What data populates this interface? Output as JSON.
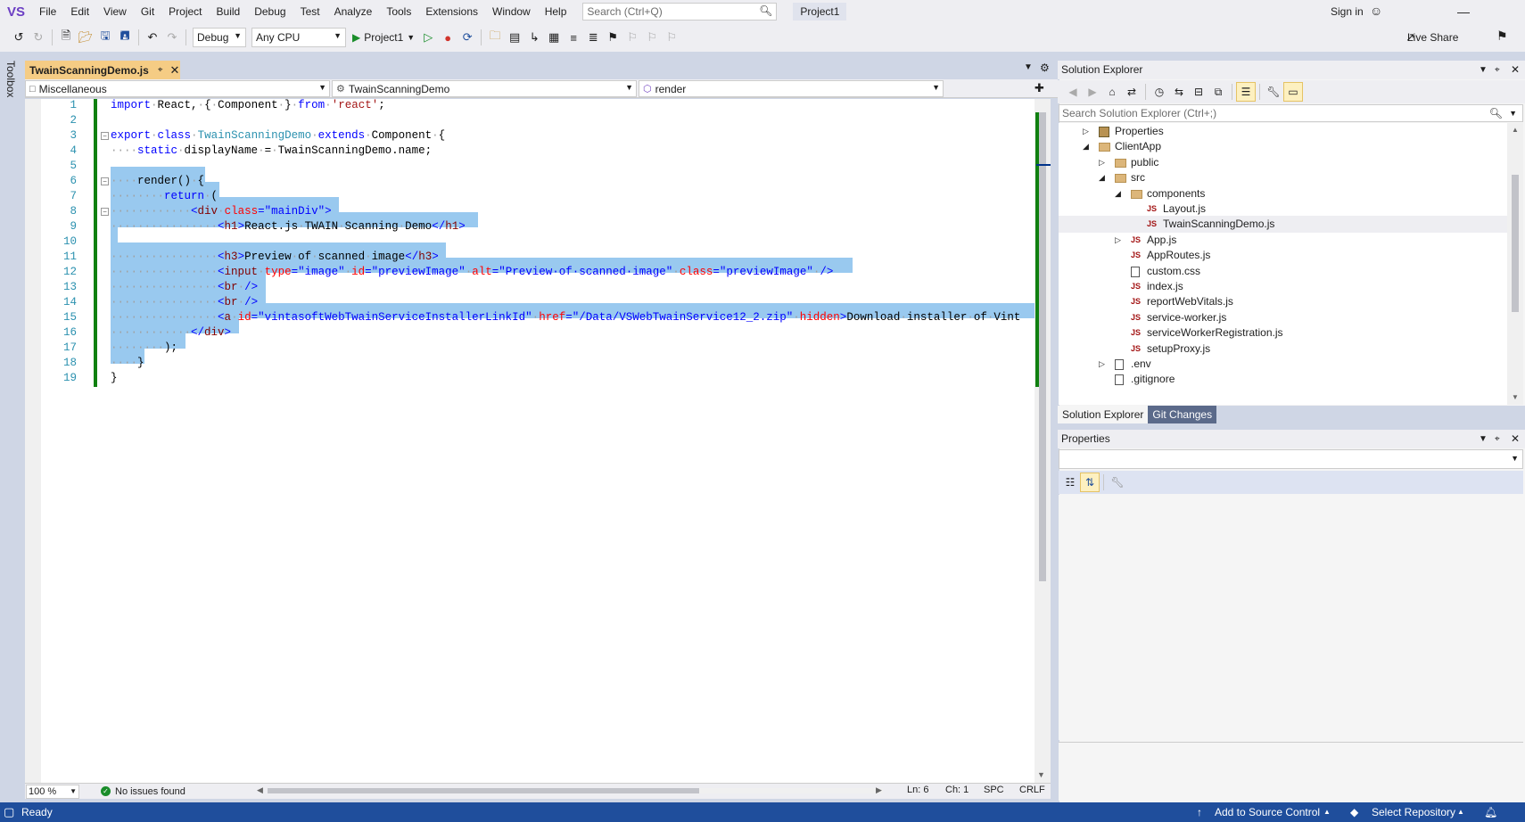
{
  "menubar": {
    "logo": "VS",
    "items": [
      "File",
      "Edit",
      "View",
      "Git",
      "Project",
      "Build",
      "Debug",
      "Test",
      "Analyze",
      "Tools",
      "Extensions",
      "Window",
      "Help"
    ],
    "search_placeholder": "Search (Ctrl+Q)",
    "project_name": "Project1",
    "sign_in": "Sign in"
  },
  "toolbar": {
    "configuration": "Debug",
    "platform": "Any CPU",
    "start_label": "Project1",
    "live_share": "Live Share"
  },
  "toolbox": {
    "label": "Toolbox"
  },
  "document_tab": {
    "title": "TwainScanningDemo.js"
  },
  "navbar": {
    "project": "Miscellaneous",
    "type": "TwainScanningDemo",
    "member": "render"
  },
  "editor": {
    "line_numbers": [
      "1",
      "2",
      "3",
      "4",
      "5",
      "6",
      "7",
      "8",
      "9",
      "10",
      "11",
      "12",
      "13",
      "14",
      "15",
      "16",
      "17",
      "18",
      "19"
    ],
    "zoom": "100 %",
    "issues": "No issues found",
    "line": "Ln: 6",
    "char": "Ch: 1",
    "spacing": "SPC",
    "line_ending": "CRLF"
  },
  "solution_explorer": {
    "title": "Solution Explorer",
    "search_placeholder": "Search Solution Explorer (Ctrl+;)",
    "tree": [
      {
        "label": "Properties",
        "type": "props",
        "level": 0,
        "expander": "collapsed"
      },
      {
        "label": "ClientApp",
        "type": "folder",
        "level": 0,
        "expander": "expanded"
      },
      {
        "label": "public",
        "type": "folder",
        "level": 1,
        "expander": "collapsed"
      },
      {
        "label": "src",
        "type": "folder",
        "level": 1,
        "expander": "expanded"
      },
      {
        "label": "components",
        "type": "folder",
        "level": 2,
        "expander": "expanded"
      },
      {
        "label": "Layout.js",
        "type": "js",
        "level": 3,
        "expander": "none"
      },
      {
        "label": "TwainScanningDemo.js",
        "type": "js",
        "level": 3,
        "expander": "none",
        "selected": true
      },
      {
        "label": "App.js",
        "type": "js",
        "level": 2,
        "expander": "collapsed"
      },
      {
        "label": "AppRoutes.js",
        "type": "js",
        "level": 2,
        "expander": "none"
      },
      {
        "label": "custom.css",
        "type": "file",
        "level": 2,
        "expander": "none"
      },
      {
        "label": "index.js",
        "type": "js",
        "level": 2,
        "expander": "none"
      },
      {
        "label": "reportWebVitals.js",
        "type": "js",
        "level": 2,
        "expander": "none"
      },
      {
        "label": "service-worker.js",
        "type": "js",
        "level": 2,
        "expander": "none"
      },
      {
        "label": "serviceWorkerRegistration.js",
        "type": "js",
        "level": 2,
        "expander": "none"
      },
      {
        "label": "setupProxy.js",
        "type": "js",
        "level": 2,
        "expander": "none"
      },
      {
        "label": ".env",
        "type": "file",
        "level": 1,
        "expander": "collapsed"
      },
      {
        "label": ".gitignore",
        "type": "file",
        "level": 1,
        "expander": "none"
      }
    ],
    "tabs": [
      "Solution Explorer",
      "Git Changes"
    ]
  },
  "properties": {
    "title": "Properties"
  },
  "statusbar": {
    "ready": "Ready",
    "source_control": "Add to Source Control",
    "repository": "Select Repository"
  },
  "colors": {
    "accent": "#1f4e9c",
    "active_tab": "#f5cc84",
    "selection": "#99c9ef",
    "change_bar": "#108010"
  }
}
